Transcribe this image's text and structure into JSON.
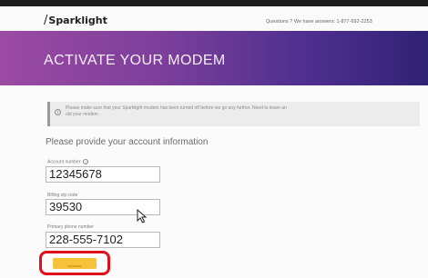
{
  "header": {
    "logo_text": "Sparklight",
    "contact_text": "Questions ? We have answers: 1-877-692-2253"
  },
  "banner": {
    "title": "ACTIVATE YOUR MODEM"
  },
  "notice": {
    "text": "Please make sure that your Sparklight modem has been turned off before we go any further. Need to leave an old your modem"
  },
  "form": {
    "heading": "Please provide your account information",
    "account_number": {
      "label": "Account number",
      "value": "12345678"
    },
    "zip_code": {
      "label": "Billing zip code",
      "value": "39530"
    },
    "phone": {
      "label": "Primary phone number",
      "value": "228-555-7102"
    }
  },
  "colors": {
    "banner_start": "#9b4aa3",
    "banner_end": "#302275",
    "button": "#f6c23a",
    "highlight": "#e0101a"
  }
}
